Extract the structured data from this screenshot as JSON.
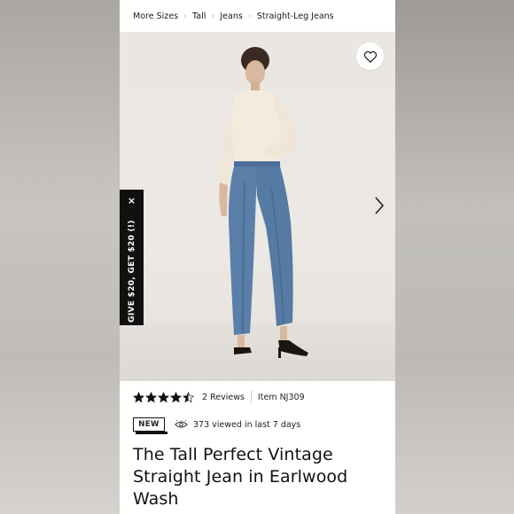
{
  "breadcrumb": {
    "items": [
      "More Sizes",
      "Tall",
      "Jeans",
      "Straight-Leg Jeans"
    ]
  },
  "promo": {
    "label": "GIVE $20, GET $20 (!)",
    "close": "×"
  },
  "hero": {
    "wishlist_icon": "heart-icon",
    "next_icon": "chevron-right-icon"
  },
  "product": {
    "rating": 4.5,
    "rating_max": 5,
    "reviews": "2 Reviews",
    "item": "Item NJ309",
    "badge": "NEW",
    "views": "373 viewed in last 7 days",
    "title": "The Tall Perfect Vintage Straight Jean in Earlwood Wash"
  },
  "colors": {
    "accent": "#111111",
    "denim": "#5a7fa8",
    "backdrop": "#eae6e2"
  }
}
